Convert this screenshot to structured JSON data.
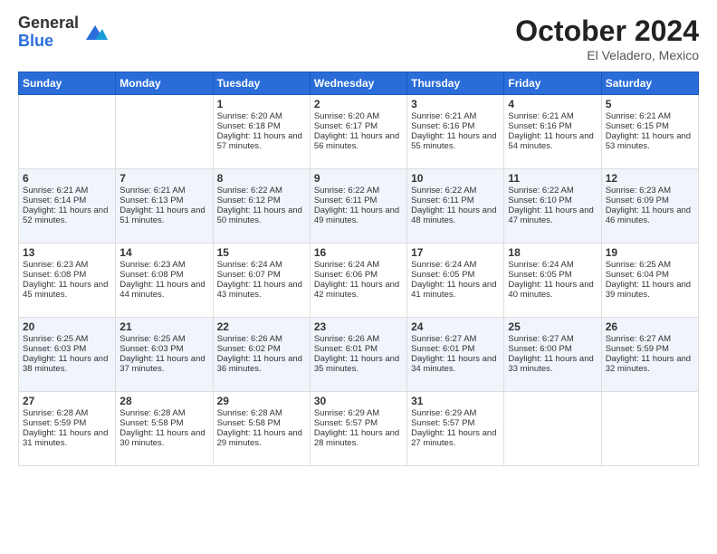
{
  "logo": {
    "general": "General",
    "blue": "Blue"
  },
  "title": "October 2024",
  "location": "El Veladero, Mexico",
  "days_of_week": [
    "Sunday",
    "Monday",
    "Tuesday",
    "Wednesday",
    "Thursday",
    "Friday",
    "Saturday"
  ],
  "weeks": [
    [
      {
        "day": "",
        "sunrise": "",
        "sunset": "",
        "daylight": ""
      },
      {
        "day": "",
        "sunrise": "",
        "sunset": "",
        "daylight": ""
      },
      {
        "day": "1",
        "sunrise": "Sunrise: 6:20 AM",
        "sunset": "Sunset: 6:18 PM",
        "daylight": "Daylight: 11 hours and 57 minutes."
      },
      {
        "day": "2",
        "sunrise": "Sunrise: 6:20 AM",
        "sunset": "Sunset: 6:17 PM",
        "daylight": "Daylight: 11 hours and 56 minutes."
      },
      {
        "day": "3",
        "sunrise": "Sunrise: 6:21 AM",
        "sunset": "Sunset: 6:16 PM",
        "daylight": "Daylight: 11 hours and 55 minutes."
      },
      {
        "day": "4",
        "sunrise": "Sunrise: 6:21 AM",
        "sunset": "Sunset: 6:16 PM",
        "daylight": "Daylight: 11 hours and 54 minutes."
      },
      {
        "day": "5",
        "sunrise": "Sunrise: 6:21 AM",
        "sunset": "Sunset: 6:15 PM",
        "daylight": "Daylight: 11 hours and 53 minutes."
      }
    ],
    [
      {
        "day": "6",
        "sunrise": "Sunrise: 6:21 AM",
        "sunset": "Sunset: 6:14 PM",
        "daylight": "Daylight: 11 hours and 52 minutes."
      },
      {
        "day": "7",
        "sunrise": "Sunrise: 6:21 AM",
        "sunset": "Sunset: 6:13 PM",
        "daylight": "Daylight: 11 hours and 51 minutes."
      },
      {
        "day": "8",
        "sunrise": "Sunrise: 6:22 AM",
        "sunset": "Sunset: 6:12 PM",
        "daylight": "Daylight: 11 hours and 50 minutes."
      },
      {
        "day": "9",
        "sunrise": "Sunrise: 6:22 AM",
        "sunset": "Sunset: 6:11 PM",
        "daylight": "Daylight: 11 hours and 49 minutes."
      },
      {
        "day": "10",
        "sunrise": "Sunrise: 6:22 AM",
        "sunset": "Sunset: 6:11 PM",
        "daylight": "Daylight: 11 hours and 48 minutes."
      },
      {
        "day": "11",
        "sunrise": "Sunrise: 6:22 AM",
        "sunset": "Sunset: 6:10 PM",
        "daylight": "Daylight: 11 hours and 47 minutes."
      },
      {
        "day": "12",
        "sunrise": "Sunrise: 6:23 AM",
        "sunset": "Sunset: 6:09 PM",
        "daylight": "Daylight: 11 hours and 46 minutes."
      }
    ],
    [
      {
        "day": "13",
        "sunrise": "Sunrise: 6:23 AM",
        "sunset": "Sunset: 6:08 PM",
        "daylight": "Daylight: 11 hours and 45 minutes."
      },
      {
        "day": "14",
        "sunrise": "Sunrise: 6:23 AM",
        "sunset": "Sunset: 6:08 PM",
        "daylight": "Daylight: 11 hours and 44 minutes."
      },
      {
        "day": "15",
        "sunrise": "Sunrise: 6:24 AM",
        "sunset": "Sunset: 6:07 PM",
        "daylight": "Daylight: 11 hours and 43 minutes."
      },
      {
        "day": "16",
        "sunrise": "Sunrise: 6:24 AM",
        "sunset": "Sunset: 6:06 PM",
        "daylight": "Daylight: 11 hours and 42 minutes."
      },
      {
        "day": "17",
        "sunrise": "Sunrise: 6:24 AM",
        "sunset": "Sunset: 6:05 PM",
        "daylight": "Daylight: 11 hours and 41 minutes."
      },
      {
        "day": "18",
        "sunrise": "Sunrise: 6:24 AM",
        "sunset": "Sunset: 6:05 PM",
        "daylight": "Daylight: 11 hours and 40 minutes."
      },
      {
        "day": "19",
        "sunrise": "Sunrise: 6:25 AM",
        "sunset": "Sunset: 6:04 PM",
        "daylight": "Daylight: 11 hours and 39 minutes."
      }
    ],
    [
      {
        "day": "20",
        "sunrise": "Sunrise: 6:25 AM",
        "sunset": "Sunset: 6:03 PM",
        "daylight": "Daylight: 11 hours and 38 minutes."
      },
      {
        "day": "21",
        "sunrise": "Sunrise: 6:25 AM",
        "sunset": "Sunset: 6:03 PM",
        "daylight": "Daylight: 11 hours and 37 minutes."
      },
      {
        "day": "22",
        "sunrise": "Sunrise: 6:26 AM",
        "sunset": "Sunset: 6:02 PM",
        "daylight": "Daylight: 11 hours and 36 minutes."
      },
      {
        "day": "23",
        "sunrise": "Sunrise: 6:26 AM",
        "sunset": "Sunset: 6:01 PM",
        "daylight": "Daylight: 11 hours and 35 minutes."
      },
      {
        "day": "24",
        "sunrise": "Sunrise: 6:27 AM",
        "sunset": "Sunset: 6:01 PM",
        "daylight": "Daylight: 11 hours and 34 minutes."
      },
      {
        "day": "25",
        "sunrise": "Sunrise: 6:27 AM",
        "sunset": "Sunset: 6:00 PM",
        "daylight": "Daylight: 11 hours and 33 minutes."
      },
      {
        "day": "26",
        "sunrise": "Sunrise: 6:27 AM",
        "sunset": "Sunset: 5:59 PM",
        "daylight": "Daylight: 11 hours and 32 minutes."
      }
    ],
    [
      {
        "day": "27",
        "sunrise": "Sunrise: 6:28 AM",
        "sunset": "Sunset: 5:59 PM",
        "daylight": "Daylight: 11 hours and 31 minutes."
      },
      {
        "day": "28",
        "sunrise": "Sunrise: 6:28 AM",
        "sunset": "Sunset: 5:58 PM",
        "daylight": "Daylight: 11 hours and 30 minutes."
      },
      {
        "day": "29",
        "sunrise": "Sunrise: 6:28 AM",
        "sunset": "Sunset: 5:58 PM",
        "daylight": "Daylight: 11 hours and 29 minutes."
      },
      {
        "day": "30",
        "sunrise": "Sunrise: 6:29 AM",
        "sunset": "Sunset: 5:57 PM",
        "daylight": "Daylight: 11 hours and 28 minutes."
      },
      {
        "day": "31",
        "sunrise": "Sunrise: 6:29 AM",
        "sunset": "Sunset: 5:57 PM",
        "daylight": "Daylight: 11 hours and 27 minutes."
      },
      {
        "day": "",
        "sunrise": "",
        "sunset": "",
        "daylight": ""
      },
      {
        "day": "",
        "sunrise": "",
        "sunset": "",
        "daylight": ""
      }
    ]
  ]
}
